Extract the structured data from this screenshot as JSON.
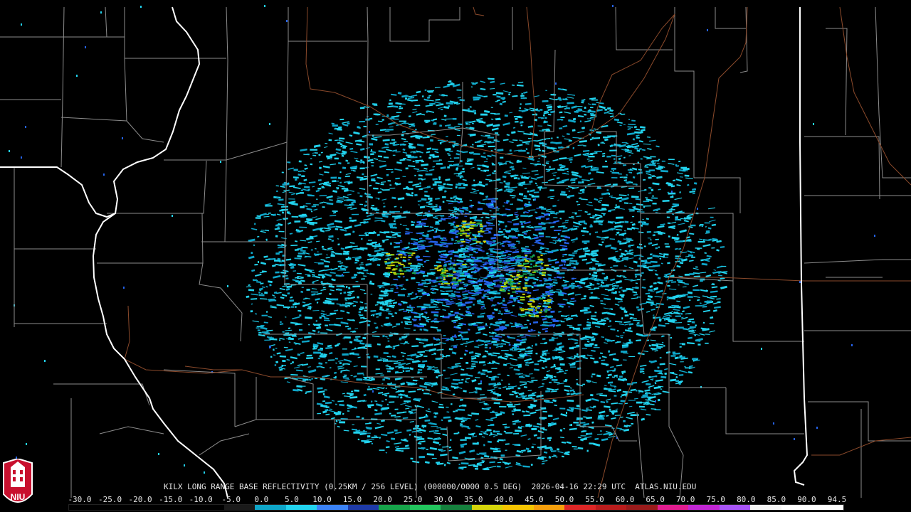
{
  "map": {
    "radar_site": "KILX",
    "caption_segments": {
      "product": "KILX LONG RANGE BASE REFLECTIVITY (0.25KM / 256 LEVEL) (000000/0000 0.5 DEG)",
      "timestamp": "2026-04-16 22:29 UTC",
      "source": "ATLAS.NIU.EDU"
    },
    "logo_text": "NIU",
    "background_color": "#000000",
    "county_line_color": "#8c8c8c",
    "state_line_color": "#ffffff",
    "highway_color": "#8b4a2b"
  },
  "scale": {
    "ticks": [
      "-30.0",
      "-25.0",
      "-20.0",
      "-15.0",
      "-10.0",
      "-5.0",
      "0.0",
      "5.0",
      "10.0",
      "15.0",
      "20.0",
      "25.0",
      "30.0",
      "35.0",
      "40.0",
      "45.0",
      "50.0",
      "55.0",
      "60.0",
      "65.0",
      "70.0",
      "75.0",
      "80.0",
      "85.0",
      "90.0",
      "94.5"
    ],
    "colors": [
      "#000000",
      "#000000",
      "#000000",
      "#000000",
      "#000000",
      "#1a1a1a",
      "#0ea5c8",
      "#22d3ee",
      "#3b82f6",
      "#1e3aa8",
      "#16a34a",
      "#22c55e",
      "#15803d",
      "#d4d40a",
      "#f5c400",
      "#f59e0b",
      "#dc2626",
      "#b91c1c",
      "#991b1b",
      "#e11d8f",
      "#c026d3",
      "#a855f7",
      "#f5f5f5",
      "#ffffff",
      "#ffffff"
    ]
  },
  "radar": {
    "echo_colors": [
      "#22d3ee",
      "#0ea5c8",
      "#2563eb",
      "#1e3aa8",
      "#16a34a",
      "#a3d40a",
      "#d4d40a"
    ]
  }
}
